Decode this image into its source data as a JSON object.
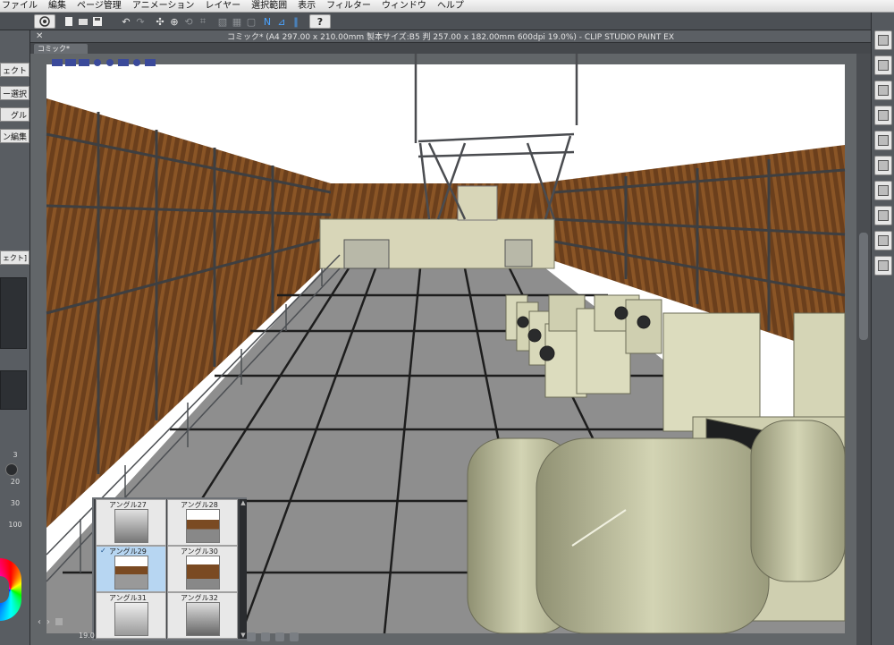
{
  "menu": [
    "ファイル",
    "編集",
    "ページ管理",
    "アニメーション",
    "レイヤー",
    "選択範囲",
    "表示",
    "フィルター",
    "ウィンドウ",
    "ヘルプ"
  ],
  "window": {
    "title": "コミック* (A4 297.00 x 210.00mm 製本サイズ:B5 判 257.00 x 182.00mm 600dpi 19.0%)  - CLIP STUDIO PAINT EX",
    "tab": "コミック*",
    "close_glyph": "✕"
  },
  "left_panel": {
    "items": [
      "ェクト",
      "ー選択",
      "グル",
      "ン編集",
      "ェクト]"
    ],
    "numbers": [
      "3",
      "20",
      "30",
      "100"
    ],
    "zoom": "19.0"
  },
  "angle_palette": {
    "items": [
      {
        "label": "アングル27",
        "selected": false
      },
      {
        "label": "アングル28",
        "selected": false
      },
      {
        "label": "アングル29",
        "selected": true
      },
      {
        "label": "アングル30",
        "selected": false
      },
      {
        "label": "アングル31",
        "selected": false
      },
      {
        "label": "アングル32",
        "selected": false
      }
    ],
    "check": "✓"
  },
  "icons": {
    "help": "?",
    "scroll_up": "▲",
    "scroll_down": "▼",
    "nav_prev": "‹",
    "nav_next": "›"
  },
  "colors": {
    "wall": "#6b3f1c",
    "floor": "#8e8e8e",
    "sky": "#ffffff",
    "selection": "#b7d6f2",
    "accent": "#4aa3ff"
  }
}
